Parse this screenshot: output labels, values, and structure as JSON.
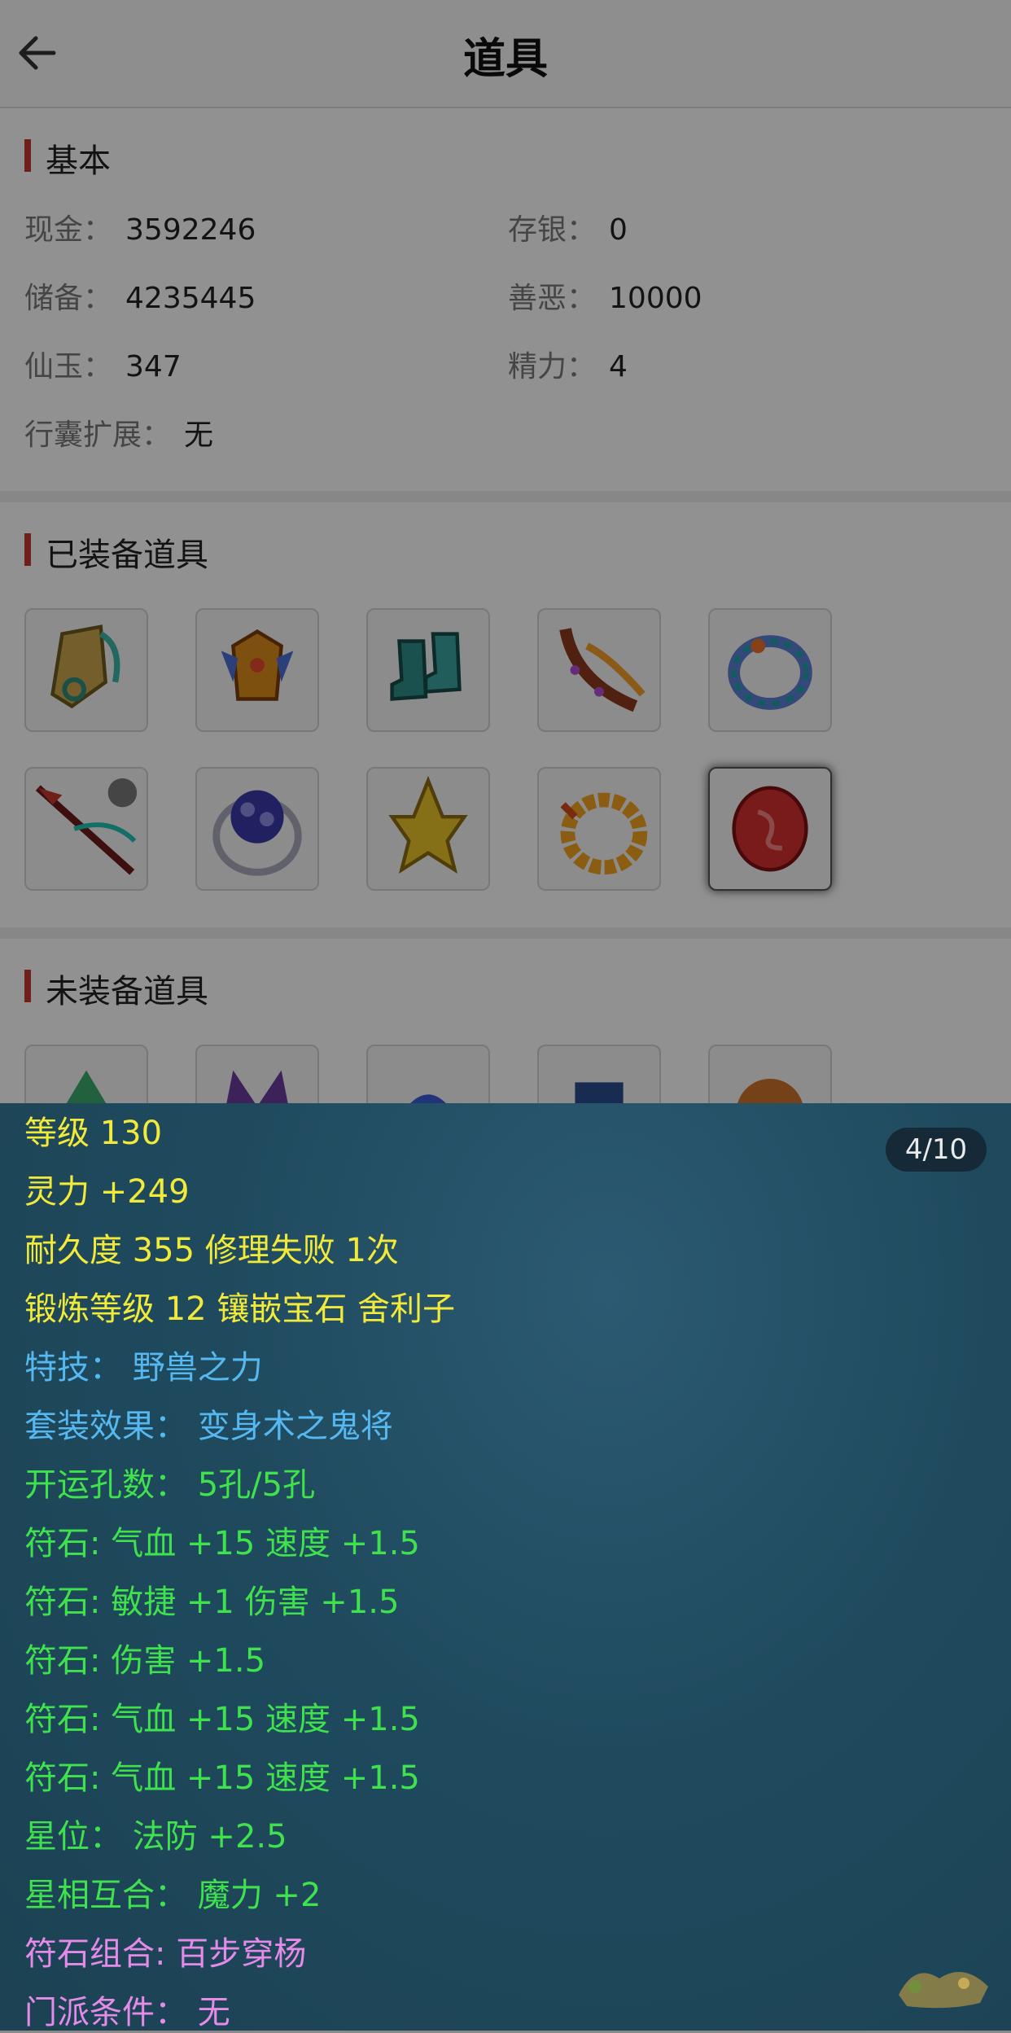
{
  "header": {
    "title": "道具"
  },
  "basic": {
    "title": "基本",
    "fields": [
      {
        "label": "现金：",
        "value": "3592246"
      },
      {
        "label": "存银：",
        "value": "0"
      },
      {
        "label": "储备：",
        "value": "4235445"
      },
      {
        "label": "善恶：",
        "value": "10000"
      },
      {
        "label": "仙玉：",
        "value": "347"
      },
      {
        "label": "精力：",
        "value": "4"
      },
      {
        "label": "行囊扩展：",
        "value": "无"
      }
    ]
  },
  "equipped": {
    "title": "已装备道具",
    "items": [
      "helmet-item",
      "armor-item",
      "boots-item",
      "belt-item",
      "ring-item",
      "weapon-item",
      "orb-ring-item",
      "golden-ornament-item",
      "bead-necklace-item",
      "red-gem-item"
    ]
  },
  "unequipped": {
    "title": "未装备道具"
  },
  "detail": {
    "counter": "4/10",
    "lines": [
      {
        "text": "等级 130",
        "color": "yellow"
      },
      {
        "text": "灵力 +249",
        "color": "yellow"
      },
      {
        "text": "耐久度 355 修理失败 1次",
        "color": "yellow"
      },
      {
        "text": "锻炼等级 12 镶嵌宝石 舍利子",
        "color": "yellow"
      },
      {
        "text": "特技：  野兽之力",
        "color": "blue"
      },
      {
        "text": "套装效果：  变身术之鬼将",
        "color": "blue"
      },
      {
        "text": "开运孔数：  5孔/5孔",
        "color": "green"
      },
      {
        "text": "符石: 气血 +15 速度 +1.5",
        "color": "green"
      },
      {
        "text": "符石: 敏捷 +1 伤害 +1.5",
        "color": "green"
      },
      {
        "text": "符石: 伤害 +1.5",
        "color": "green"
      },
      {
        "text": "符石: 气血 +15 速度 +1.5",
        "color": "green"
      },
      {
        "text": "符石: 气血 +15 速度 +1.5",
        "color": "green"
      },
      {
        "text": "星位：  法防 +2.5",
        "color": "green"
      },
      {
        "text": "星相互合：  魔力 +2",
        "color": "green"
      },
      {
        "text": "符石组合: 百步穿杨",
        "color": "pink"
      },
      {
        "text": "门派条件：  无",
        "color": "pink"
      }
    ]
  },
  "colors": {
    "accent": "#c0392b",
    "yellow": "#f2ea3a",
    "blue": "#55b8f0",
    "green": "#3fe24d",
    "pink": "#e48ae8"
  }
}
